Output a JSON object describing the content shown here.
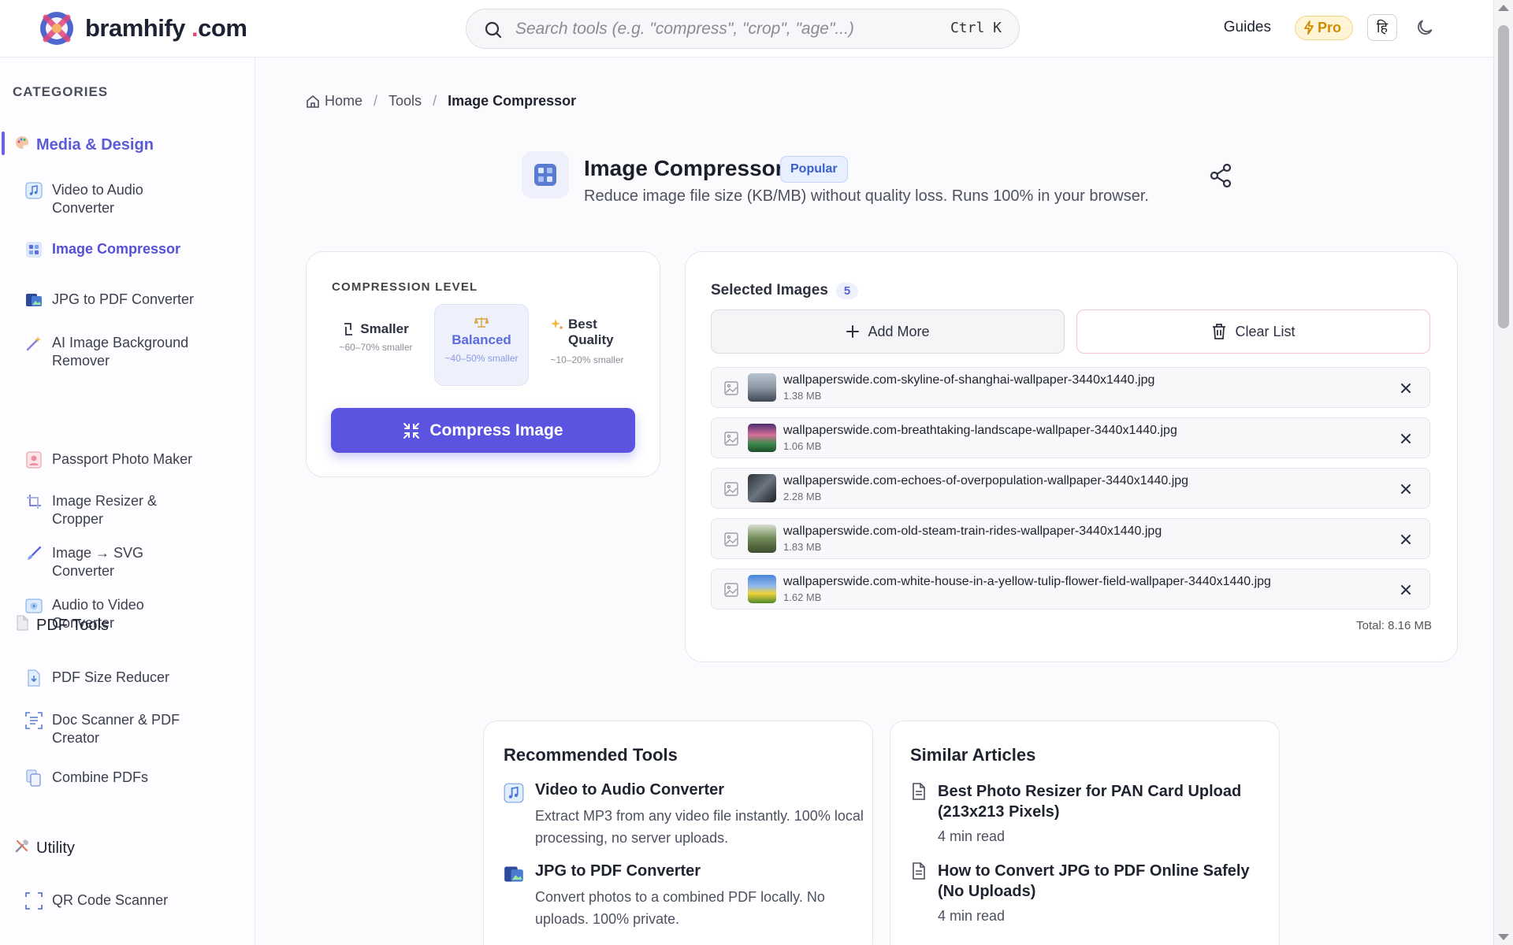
{
  "header": {
    "brand_name": "bramhify",
    "brand_dot": ".",
    "brand_tld": "com",
    "search_placeholder": "Search tools (e.g. \"compress\", \"crop\", \"age\"...)",
    "shortcut": "Ctrl K",
    "guides_label": "Guides",
    "pro_label": "Pro",
    "lang_glyph": "हि"
  },
  "sidebar": {
    "title": "CATEGORIES",
    "groups": [
      {
        "label": "Media & Design",
        "icon": "palette-icon",
        "items": [
          {
            "label": "Video to Audio Converter",
            "icon": "music-icon"
          },
          {
            "label": "Image Compressor",
            "icon": "grid-image-icon"
          },
          {
            "label": "JPG to PDF Converter",
            "icon": "image-pdf-icon"
          },
          {
            "label": "AI Image Background Remover",
            "icon": "magic-wand-icon"
          },
          {
            "label": "Passport Photo Maker",
            "icon": "portrait-icon"
          },
          {
            "label": "Image Resizer & Cropper",
            "icon": "crop-icon"
          },
          {
            "label": "Image → SVG Converter",
            "icon": "brush-icon"
          },
          {
            "label": "Audio to Video Converter",
            "icon": "video-icon"
          }
        ]
      },
      {
        "label": "PDF Tools",
        "icon": "pdf-icon",
        "items": [
          {
            "label": "PDF Size Reducer",
            "icon": "file-down-icon"
          },
          {
            "label": "Doc Scanner & PDF Creator",
            "icon": "scanner-icon"
          },
          {
            "label": "Combine PDFs",
            "icon": "files-icon"
          }
        ]
      },
      {
        "label": "Utility",
        "icon": "tools-icon",
        "items": [
          {
            "label": "QR Code Scanner",
            "icon": "scan-icon"
          }
        ]
      }
    ]
  },
  "breadcrumb": {
    "home": "Home",
    "tools": "Tools",
    "current": "Image Compressor",
    "sep": "/"
  },
  "tool": {
    "title": "Image Compressor",
    "badge": "Popular",
    "description": "Reduce image file size (KB/MB) without quality loss. Runs 100% in your browser."
  },
  "compression": {
    "label": "COMPRESSION LEVEL",
    "levels": [
      {
        "name": "Smaller",
        "desc": "~60–70% smaller",
        "selected": false
      },
      {
        "name": "Balanced",
        "desc": "~40–50% smaller",
        "selected": true
      },
      {
        "name": "Best Quality",
        "desc": "~10–20% smaller",
        "selected": false
      }
    ],
    "button": "Compress Image"
  },
  "images": {
    "title": "Selected Images",
    "count": "5",
    "add_more": "Add More",
    "clear_list": "Clear List",
    "files": [
      {
        "name": "wallpaperswide.com-skyline-of-shanghai-wallpaper-3440x1440.jpg",
        "size": "1.38 MB"
      },
      {
        "name": "wallpaperswide.com-breathtaking-landscape-wallpaper-3440x1440.jpg",
        "size": "1.06 MB"
      },
      {
        "name": "wallpaperswide.com-echoes-of-overpopulation-wallpaper-3440x1440.jpg",
        "size": "2.28 MB"
      },
      {
        "name": "wallpaperswide.com-old-steam-train-rides-wallpaper-3440x1440.jpg",
        "size": "1.83 MB"
      },
      {
        "name": "wallpaperswide.com-white-house-in-a-yellow-tulip-flower-field-wallpaper-3440x1440.jpg",
        "size": "1.62 MB"
      }
    ],
    "total": "Total: 8.16 MB"
  },
  "recommended": {
    "title": "Recommended Tools",
    "items": [
      {
        "title": "Video to Audio Converter",
        "desc": "Extract MP3 from any video file instantly. 100% local processing, no server uploads."
      },
      {
        "title": "JPG to PDF Converter",
        "desc": "Convert photos to a combined PDF locally. No uploads. 100% private."
      }
    ]
  },
  "articles": {
    "title": "Similar Articles",
    "items": [
      {
        "title": "Best Photo Resizer for PAN Card Upload (213x213 Pixels)",
        "read": "4 min read"
      },
      {
        "title": "How to Convert JPG to PDF Online Safely (No Uploads)",
        "read": "4 min read"
      }
    ]
  },
  "colors": {
    "accent": "#5b54e0",
    "badge": "#3a5fc9",
    "pro": "#d18b00"
  }
}
